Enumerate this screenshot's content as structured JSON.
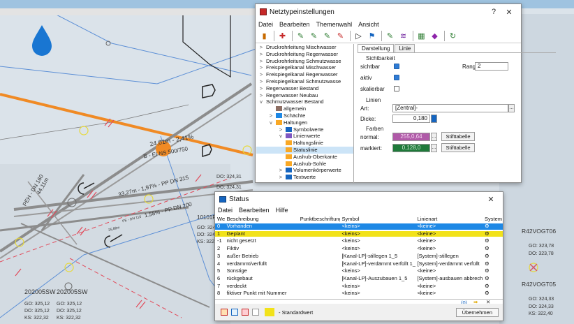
{
  "map": {
    "labels": {
      "pipe1": "24,01m - 2,41%",
      "pipe2": "B - EI NS 500/750",
      "pipe3": "33,27m - 1,97% - PP DN 315",
      "pipe4": "1,58% - PP DN 200",
      "pipe5": "44,11m",
      "pipe6": "PEH - DN 160",
      "pipe7": "25,88m",
      "pipe8": "PE - DN 110",
      "node_do1": "DO: 324,31",
      "node_do2": "DO: 324,31",
      "node_101": "10101F",
      "node_go": "GO: 324,1",
      "node_do3": "DO: 324,1",
      "node_ks": "KS: 322,1",
      "left1_name": "202005SW",
      "left2_name": "202005SW",
      "left1_go": "GO: 325,12",
      "left1_do": "DO: 325,12",
      "left1_ks": "KS: 322,32",
      "left2_go": "GO: 325,12",
      "left2_do": "DO: 325,12",
      "left2_ks": "KS: 322,32",
      "r1_name": "R42VOGT06",
      "r1_go": "GO: 323,78",
      "r1_do": "DO: 323,78",
      "r2_name": "R42VOGT05",
      "r2_go": "GO: 324,33",
      "r2_do": "DO: 324,33",
      "r2_ks": "KS: 322,40"
    }
  },
  "netz": {
    "title": "Netztypeinstellungen",
    "help": "?",
    "close": "✕",
    "menu": [
      "Datei",
      "Bearbeiten",
      "Themenwahl",
      "Ansicht"
    ],
    "tree": [
      {
        "label": "Druckrohrleitung Mischwasser",
        "chev": ">"
      },
      {
        "label": "Druckrohrleitung Regenwasser",
        "chev": ">"
      },
      {
        "label": "Druckrohrleitung Schmutzwasse",
        "chev": ">"
      },
      {
        "label": "Freispiegelkanal Mischwasser",
        "chev": ">"
      },
      {
        "label": "Freispiegelkanal Regenwasser",
        "chev": ">"
      },
      {
        "label": "Freispiegelkanal Schmutzwasse",
        "chev": ">"
      },
      {
        "label": "Regenwasser Bestand",
        "chev": ">"
      },
      {
        "label": "Regenwasser Neubau",
        "chev": ">"
      },
      {
        "label": "Schmutzwasser Bestand",
        "chev": "v"
      },
      {
        "label": "allgemein",
        "chev": ""
      },
      {
        "label": "Schächte",
        "chev": ">"
      },
      {
        "label": "Haltungen",
        "chev": "v"
      },
      {
        "label": "Symbolwerte",
        "chev": ">"
      },
      {
        "label": "Linienwerte",
        "chev": "v"
      },
      {
        "label": "Haltungslinie",
        "chev": ""
      },
      {
        "label": "Statuslinie",
        "chev": ""
      },
      {
        "label": "Aushub-Oberkante",
        "chev": ""
      },
      {
        "label": "Aushub-Sohle",
        "chev": ""
      },
      {
        "label": "Volumenkörperwerte",
        "chev": ">"
      },
      {
        "label": "Textwerte",
        "chev": ">"
      }
    ],
    "tabs": [
      "Darstellung",
      "Linie"
    ],
    "sichtbarkeit": "Sichtbarkeit",
    "sichtbar": "sichtbar",
    "aktiv": "aktiv",
    "skalierbar": "skalierbar",
    "rang_label": "Rang:",
    "rang_value": "2",
    "linien": "Linien",
    "art_label": "Art:",
    "art_value": "[Zentral]-",
    "dicke_label": "Dicke:",
    "dicke_value": "0,180",
    "farben": "Farben",
    "normal_label": "normal:",
    "normal_value": "255,0,64",
    "normal_color": "#b05aa8",
    "markiert_label": "markiert:",
    "markiert_value": "0,128,0",
    "markiert_color": "#1f7a3a",
    "stift": "Stifttabelle",
    "stift2": "Stifttabelle"
  },
  "status": {
    "title": "Status",
    "close": "✕",
    "menu": [
      "Datei",
      "Bearbeiten",
      "Hilfe"
    ],
    "headers": [
      "Wert",
      "Beschreibung",
      "Punktbeschriftung",
      "Symbol",
      "Linienart",
      "System"
    ],
    "rows": [
      {
        "wert": "0",
        "besch": "Vorhanden",
        "punkt": "",
        "symbol": "<keins>",
        "linie": "<keine>",
        "hl": "blue"
      },
      {
        "wert": "1",
        "besch": "Geplant",
        "punkt": "",
        "symbol": "<keins>",
        "linie": "<keine>",
        "hl": "yellow"
      },
      {
        "wert": "-1",
        "besch": "nicht gesetzt",
        "punkt": "",
        "symbol": "<keins>",
        "linie": "<keine>",
        "hl": ""
      },
      {
        "wert": "2",
        "besch": "Fiktiv",
        "punkt": "",
        "symbol": "<keins>",
        "linie": "<keine>",
        "hl": ""
      },
      {
        "wert": "3",
        "besch": "außer Betrieb",
        "punkt": "",
        "symbol": "[Kanal-LP]-stillegen 1_5",
        "linie": "[System]-stillegen",
        "hl": ""
      },
      {
        "wert": "4",
        "besch": "verdämmt/verfüllt",
        "punkt": "",
        "symbol": "[Kanal-LP]-verdämmt verfüllt 1_5",
        "linie": "[System]-verdämmt verfüllt",
        "hl": ""
      },
      {
        "wert": "5",
        "besch": "Sonstige",
        "punkt": "",
        "symbol": "<keins>",
        "linie": "<keine>",
        "hl": ""
      },
      {
        "wert": "6",
        "besch": "rückgebaut",
        "punkt": "",
        "symbol": "[Kanal-LP]-Auszubauen 1_5",
        "linie": "[System]-ausbauen abbrechen",
        "hl": ""
      },
      {
        "wert": "7",
        "besch": "verdeckt",
        "punkt": "",
        "symbol": "<keins>",
        "linie": "<keine>",
        "hl": ""
      },
      {
        "wert": "8",
        "besch": "fiktiver Punkt mit Nummer",
        "punkt": "",
        "symbol": "<keins>",
        "linie": "<keine>",
        "hl": ""
      }
    ],
    "count": "(0)",
    "standard": "- Standardwert",
    "uebernehmen": "Übernehmen",
    "blue": "#1e88e5",
    "yellow": "#f2e21a"
  }
}
